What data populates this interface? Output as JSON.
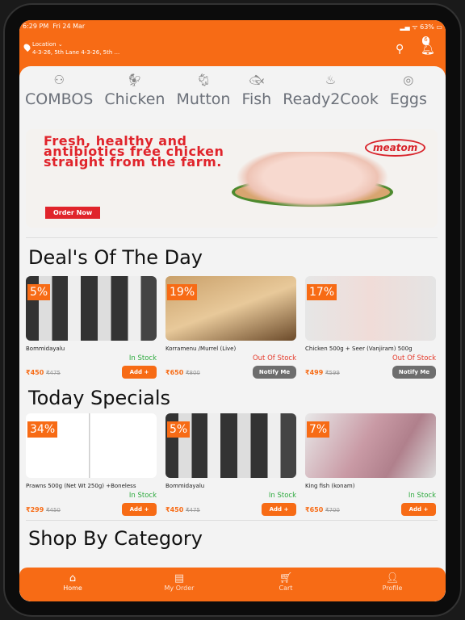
{
  "status": {
    "time": "6:29 PM",
    "date": "Fri 24 Mar",
    "battery": "63%"
  },
  "header": {
    "location_label": "Location ⌄",
    "address": "4-3-26, 5th Lane 4-3-26, 5th ...",
    "notification_count": "6"
  },
  "categories": [
    {
      "label": "COMBOS",
      "icon": "combo-icon"
    },
    {
      "label": "Chicken",
      "icon": "chicken-icon"
    },
    {
      "label": "Mutton",
      "icon": "goat-icon"
    },
    {
      "label": "Fish",
      "icon": "fish-icon"
    },
    {
      "label": "Ready2Cook",
      "icon": "cook-icon"
    },
    {
      "label": "Eggs",
      "icon": "egg-icon"
    }
  ],
  "banner": {
    "headline": "Fresh, healthy and antibiotics free chicken straight from the farm.",
    "button": "Order Now",
    "brand": "meatom"
  },
  "deals": {
    "title": "Deal's Of The Day",
    "items": [
      {
        "discount": "5%",
        "name": "Bommidayalu",
        "stock": "In Stock",
        "price": "₹450",
        "mrp": "₹475",
        "action": "Add +"
      },
      {
        "discount": "19%",
        "name": "Korramenu /Murrel (Live)",
        "stock": "Out Of Stock",
        "price": "₹650",
        "mrp": "₹800",
        "action": "Notify Me"
      },
      {
        "discount": "17%",
        "name": "Chicken 500g + Seer (Vanjiram) 500g",
        "stock": "Out Of Stock",
        "price": "₹499",
        "mrp": "₹599",
        "action": "Notify Me"
      }
    ]
  },
  "specials": {
    "title": "Today Specials",
    "items": [
      {
        "discount": "34%",
        "name": "Prawns 500g (Net Wt 250g) +Boneless",
        "stock": "In Stock",
        "price": "₹299",
        "mrp": "₹450",
        "action": "Add +"
      },
      {
        "discount": "5%",
        "name": "Bommidayalu",
        "stock": "In Stock",
        "price": "₹450",
        "mrp": "₹475",
        "action": "Add +"
      },
      {
        "discount": "7%",
        "name": "King fish (konam)",
        "stock": "In Stock",
        "price": "₹650",
        "mrp": "₹700",
        "action": "Add +"
      }
    ]
  },
  "shop_by_category": "Shop By Category",
  "nav": [
    {
      "label": "Home"
    },
    {
      "label": "My Order"
    },
    {
      "label": "Cart"
    },
    {
      "label": "Profile"
    }
  ],
  "colors": {
    "accent": "#f76b15",
    "in_stock": "#2eaa3f",
    "out_of_stock": "#e53b2c"
  }
}
